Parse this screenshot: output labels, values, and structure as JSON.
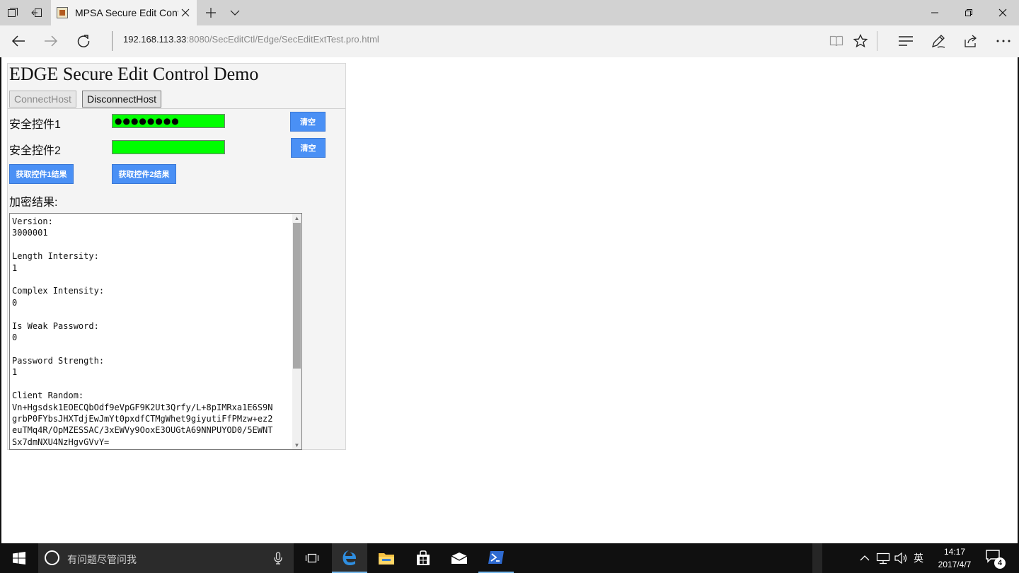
{
  "browser": {
    "tab": {
      "title": "MPSA Secure Edit Control"
    },
    "address": {
      "host": "192.168.113.33",
      "rest": ":8080/SecEditCtl/Edge/SecEditExtTest.pro.html"
    }
  },
  "page": {
    "title": "EDGE Secure Edit Control Demo",
    "connect_label": "ConnectHost",
    "disconnect_label": "DisconnectHost",
    "control1_label": "安全控件1",
    "control1_value": "●●●●●●●●",
    "control2_label": "安全控件2",
    "control2_value": "",
    "clear_label": "清空",
    "get_result1_label": "获取控件1结果",
    "get_result2_label": "获取控件2结果",
    "result_label": "加密结果:",
    "result_text": "Version:\n3000001\n\nLength Intersity:\n1\n\nComplex Intensity:\n0\n\nIs Weak Password:\n0\n\nPassword Strength:\n1\n\nClient Random:\nVn+Hgsdsk1EOECQbOdf9eVpGF9K2Ut3Qrfy/L+8pIMRxa1E6S9N\ngrbP0FYbsJHXTdjEwJmYt0pxdfCTMgWhet9giyutiFfPMzw+ez2\neuTMq4R/OpMZESSAC/3xEWVy9OoxE3OUGtA69NNPUYOD0/5EWNT\nSx7dmNXU4NzHgvGVvY="
  },
  "taskbar": {
    "search_placeholder": "有问题尽管问我",
    "ime": "英",
    "time": "14:17",
    "date": "2017/4/7",
    "notification_count": "4"
  },
  "colors": {
    "secure_field": "#00ff00",
    "action_button": "#4a90f5"
  }
}
